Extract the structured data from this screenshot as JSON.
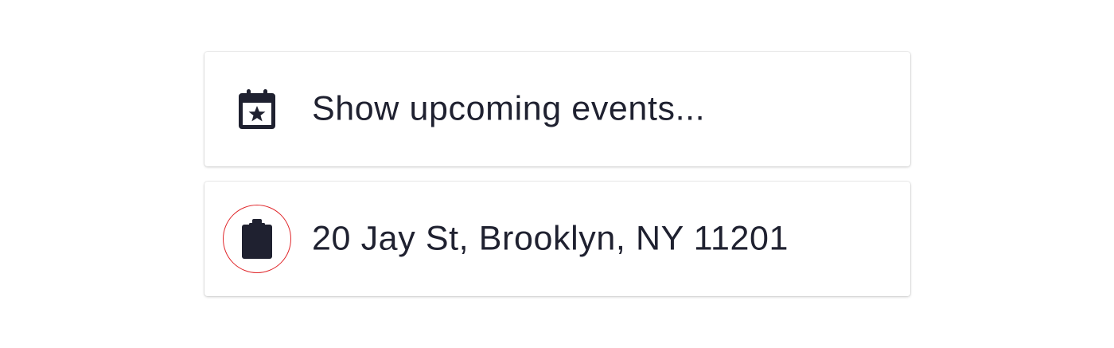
{
  "accent": "#1f2130",
  "highlight_color": "#e0262a",
  "items": [
    {
      "icon": "calendar-star-icon",
      "label": "Show upcoming events..."
    },
    {
      "icon": "clipboard-icon",
      "label": "20 Jay St, Brooklyn, NY 11201"
    }
  ]
}
